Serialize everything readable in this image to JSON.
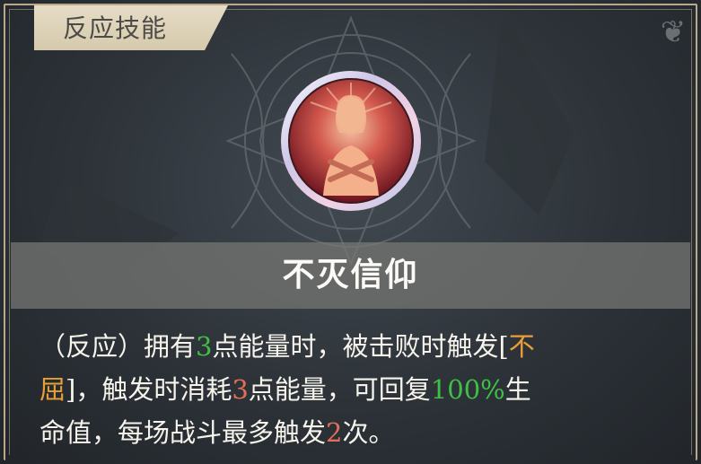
{
  "tab": {
    "label": "反应技能"
  },
  "skill": {
    "name": "不灭信仰",
    "desc": {
      "p1": "（反应）拥有",
      "v1": "3",
      "p2": "点能量时，被击败时触发[",
      "t1": "不",
      "t2": "屈",
      "p3": "]，触发时消耗",
      "v2": "3",
      "p4": "点能量，可回复",
      "v3": "100%",
      "p5": "生",
      "p6": "命值，每场战斗最多触发",
      "v4": "2",
      "p7": "次。"
    }
  },
  "colors": {
    "accent_green": "#3fbf45",
    "accent_red": "#e36f5a",
    "accent_orange": "#e8a036",
    "tab_bg": "#e6dcc6"
  },
  "icons": {
    "portrait": "praying-saint-portrait-icon",
    "corner": "fleur-ornament-icon"
  }
}
